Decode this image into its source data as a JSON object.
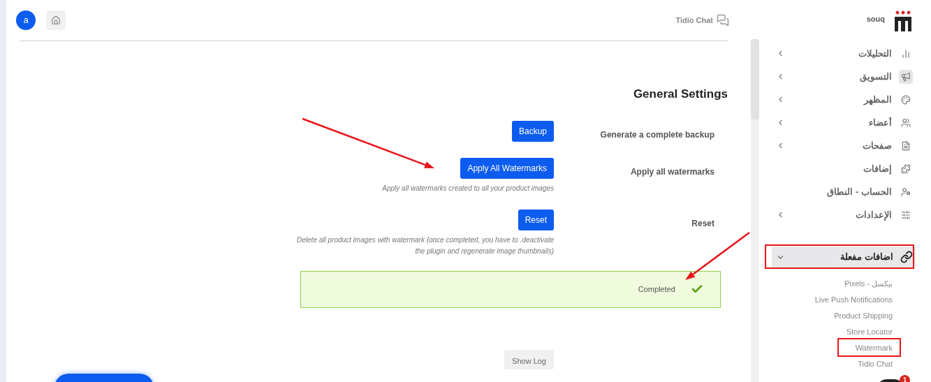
{
  "header": {
    "avatar": "a",
    "app_link": "Tidio Chat"
  },
  "store": {
    "name": "souq"
  },
  "sidebar": {
    "items": [
      {
        "label": "التحليلات",
        "has_submenu": true,
        "highlighted": false
      },
      {
        "label": "التسويق",
        "has_submenu": true,
        "highlighted": true
      },
      {
        "label": "المظهر",
        "has_submenu": true,
        "highlighted": false
      },
      {
        "label": "أعضاء",
        "has_submenu": true,
        "highlighted": false
      },
      {
        "label": "صفحات",
        "has_submenu": true,
        "highlighted": false
      },
      {
        "label": "إضافات",
        "has_submenu": false,
        "highlighted": false
      },
      {
        "label": "الحساب - النطاق",
        "has_submenu": false,
        "highlighted": false
      },
      {
        "label": "الإعدادات",
        "has_submenu": true,
        "highlighted": false
      }
    ],
    "active_group": {
      "label": "اضافات مفعلة",
      "expanded": true,
      "children": [
        "بيكسل - Pixels",
        "Live Push Notifications",
        "Product Shipping",
        "Store Locator",
        "Watermark",
        "Tidio Chat"
      ]
    }
  },
  "settings": {
    "title": "General Settings",
    "rows": [
      {
        "label": "Generate a complete backup",
        "button": "Backup",
        "description": ""
      },
      {
        "label": "Apply all watermarks",
        "button": "Apply All Watermarks",
        "description": "Apply all watermarks created to all your product images"
      },
      {
        "label": "Reset",
        "button": "Reset",
        "description": "Delete all product images with watermark (once completed, you have to .deactivate the plugin and regenerate image thumbnails)"
      }
    ],
    "status": {
      "text": "Completed",
      "success": true
    },
    "show_log": "Show Log"
  },
  "chat_widget": {
    "badge": "1"
  }
}
